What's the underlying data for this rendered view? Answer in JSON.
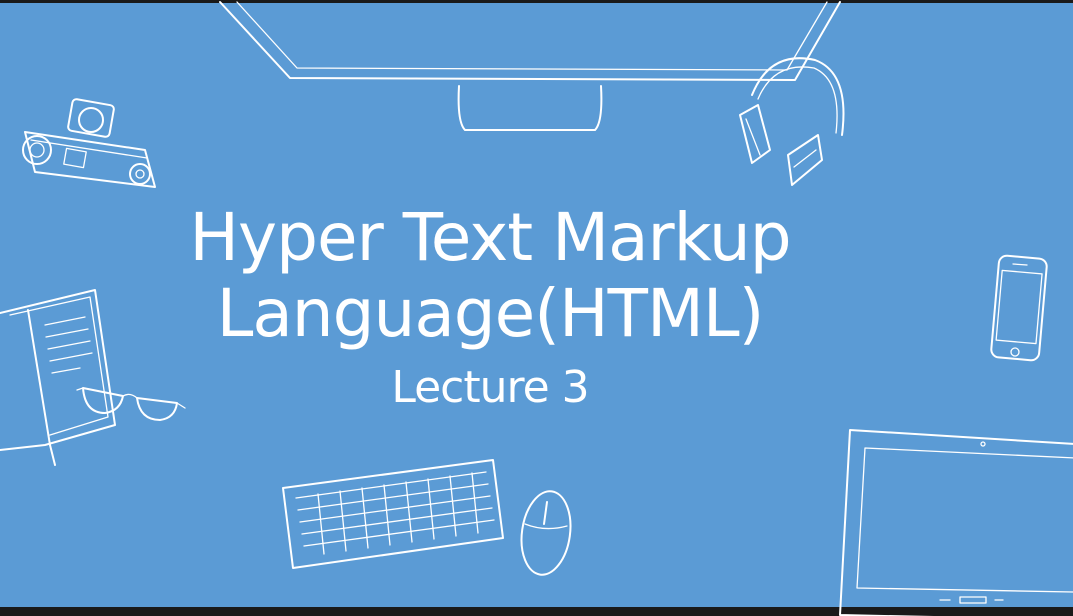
{
  "slide": {
    "title_line1": "Hyper Text Markup",
    "title_line2": "Language(HTML)",
    "subtitle": "Lecture 3",
    "background_color": "#5b9bd5",
    "bottom_bar_color": "#1a1a1a",
    "line_color": "#ffffff"
  },
  "illustrations": [
    "monitor-icon",
    "headphones-icon",
    "camera-icon",
    "smartphone-icon",
    "notebook-icon",
    "glasses-icon",
    "keyboard-icon",
    "mouse-icon",
    "tablet-icon"
  ]
}
